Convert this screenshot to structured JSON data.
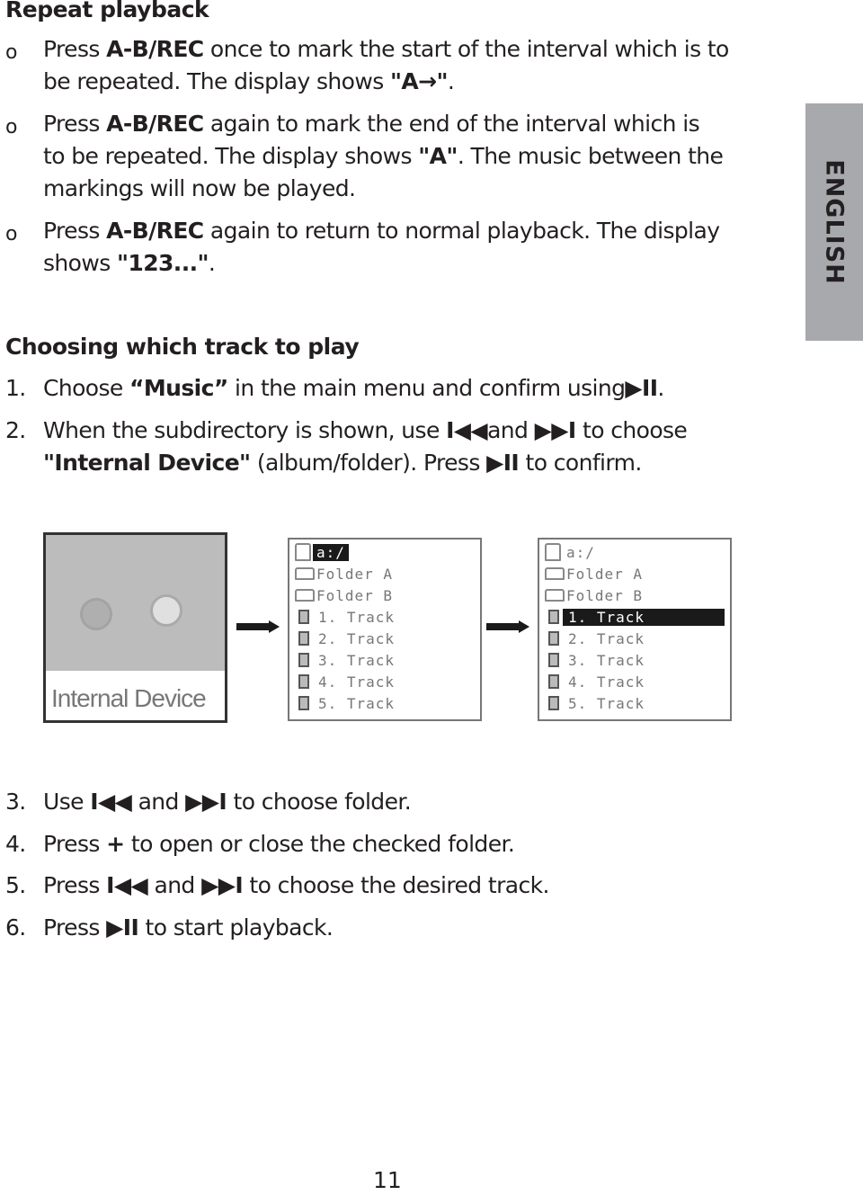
{
  "side_tab": {
    "label": "ENGLISH"
  },
  "section1": {
    "heading": "Repeat playback",
    "bullet_glyph": "o",
    "items": [
      {
        "l1a": "Press ",
        "l1b": "A-B/REC",
        "l1c": " once to mark the start of the interval which is to",
        "l2a": "be repeated. The display shows ",
        "l2b": "\"A→\"",
        "l2c": "."
      },
      {
        "l1a": "Press ",
        "l1b": "A-B/REC",
        "l1c": " again to mark the end of the interval which is",
        "l2a": "to be repeated. The display shows ",
        "l2b": "\"A\"",
        "l2c": ". The music between the",
        "l3": "markings will now be played."
      },
      {
        "l1a": "Press ",
        "l1b": "A-B/REC",
        "l1c": " again to return to normal playback. The display",
        "l2a": "shows ",
        "l2b": "\"123...\"",
        "l2c": "."
      }
    ]
  },
  "section2": {
    "heading": "Choosing which track to play",
    "steps": [
      {
        "n": "1.",
        "a": "Choose ",
        "b": "“Music”",
        "c": " in the main menu and confirm using",
        "d": "▶II",
        "e": "."
      },
      {
        "n": "2.",
        "l1a": "When the subdirectory is shown, use ",
        "l1b": "I◀◀",
        "l1c": "and ",
        "l1d": "▶▶I",
        "l1e": " to choose",
        "l2a": "\"Internal Device\"",
        "l2b": " (album/folder). Press ",
        "l2c": "▶II",
        "l2d": " to confirm."
      },
      {
        "n": "3.",
        "a": "Use ",
        "b": "I◀◀",
        "c": " and ",
        "d": "▶▶I",
        "e": " to choose folder."
      },
      {
        "n": "4.",
        "a": "Press ",
        "b": "+",
        "c": " to open or close the checked folder."
      },
      {
        "n": "5.",
        "a": "Press ",
        "b": "I◀◀",
        "c": " and ",
        "d": "▶▶I",
        "e": " to choose the desired track."
      },
      {
        "n": "6.",
        "a": "Press ",
        "b": "▶II",
        "c": " to start playback."
      }
    ]
  },
  "screens": {
    "device_label": "Internal Device",
    "root": "a:/",
    "folders": [
      "Folder A",
      "Folder B"
    ],
    "tracks": [
      "1. Track",
      "2. Track",
      "3. Track",
      "4. Track",
      "5. Track"
    ],
    "highlight_screen2": "a:/",
    "highlight_screen3": "1. Track"
  },
  "page_number": "11"
}
